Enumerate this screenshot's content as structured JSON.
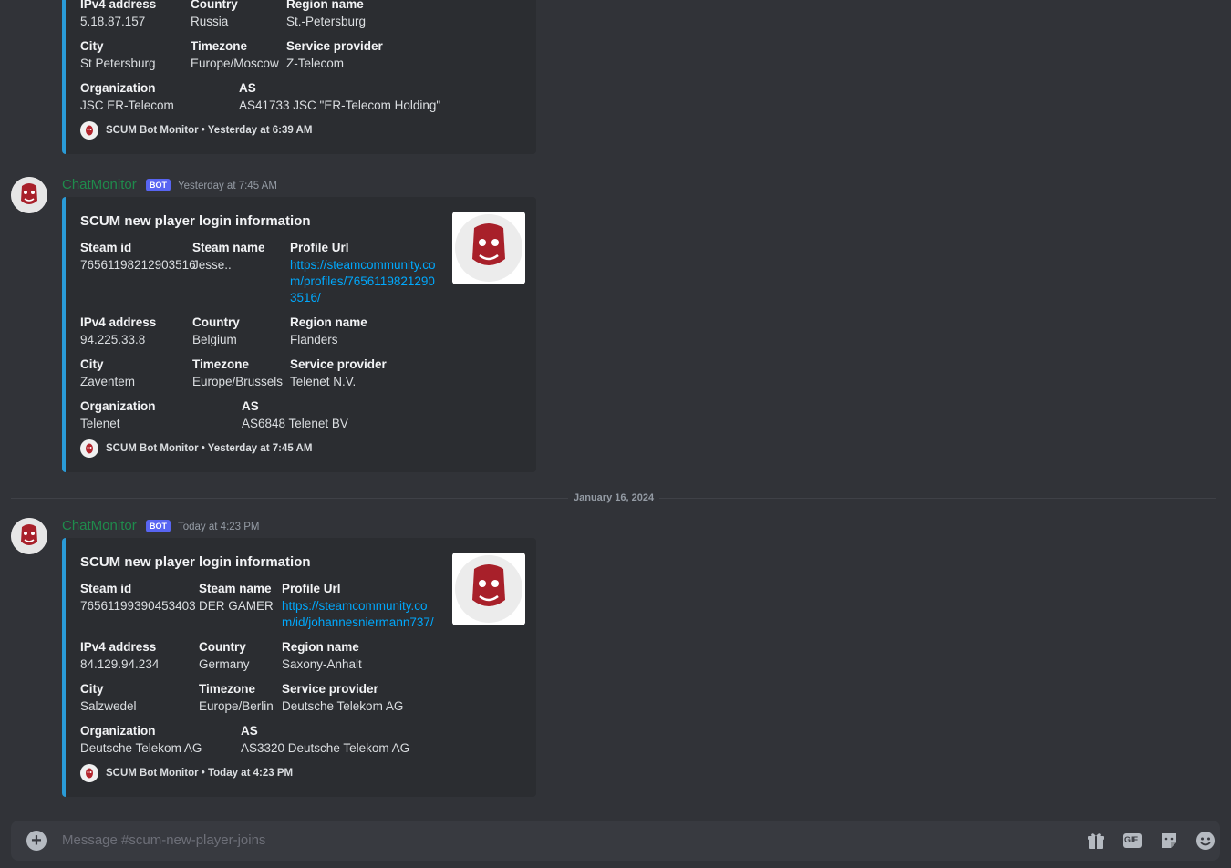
{
  "top_embed": {
    "row1": {
      "f1_name": "IPv4 address",
      "f1_value": "5.18.87.157",
      "f2_name": "Country",
      "f2_value": "Russia",
      "f3_name": "Region name",
      "f3_value": "St.-Petersburg"
    },
    "row2": {
      "f1_name": "City",
      "f1_value": "St Petersburg",
      "f2_name": "Timezone",
      "f2_value": "Europe/Moscow",
      "f3_name": "Service provider",
      "f3_value": "Z-Telecom"
    },
    "row3": {
      "f1_name": "Organization",
      "f1_value": "JSC ER-Telecom",
      "f2_name": "AS",
      "f2_value": "AS41733 JSC \"ER-Telecom Holding\""
    },
    "footer": "SCUM Bot Monitor • Yesterday at 6:39 AM"
  },
  "messages": [
    {
      "username": "ChatMonitor",
      "bot_tag": "BOT",
      "timestamp": "Yesterday at 7:45 AM",
      "embed": {
        "title": "SCUM new player login information",
        "row1": {
          "f1_name": "Steam id",
          "f1_value": "76561198212903516",
          "f2_name": "Steam name",
          "f2_value": "Jesse..",
          "f3_name": "Profile Url",
          "f3_value": "https://steamcommunity.com/profiles/76561198212903516/"
        },
        "row2": {
          "f1_name": "IPv4 address",
          "f1_value": "94.225.33.8",
          "f2_name": "Country",
          "f2_value": "Belgium",
          "f3_name": "Region name",
          "f3_value": "Flanders"
        },
        "row3": {
          "f1_name": "City",
          "f1_value": "Zaventem",
          "f2_name": "Timezone",
          "f2_value": "Europe/Brussels",
          "f3_name": "Service provider",
          "f3_value": "Telenet N.V."
        },
        "row4": {
          "f1_name": "Organization",
          "f1_value": "Telenet",
          "f2_name": "AS",
          "f2_value": "AS6848 Telenet BV"
        },
        "footer": "SCUM Bot Monitor • Yesterday at 7:45 AM"
      }
    },
    {
      "username": "ChatMonitor",
      "bot_tag": "BOT",
      "timestamp": "Today at 4:23 PM",
      "embed": {
        "title": "SCUM new player login information",
        "row1": {
          "f1_name": "Steam id",
          "f1_value": "76561199390453403",
          "f2_name": "Steam name",
          "f2_value": "DER GAMER",
          "f3_name": "Profile Url",
          "f3_value": "https://steamcommunity.com/id/johannesniermann737/"
        },
        "row2": {
          "f1_name": "IPv4 address",
          "f1_value": "84.129.94.234",
          "f2_name": "Country",
          "f2_value": "Germany",
          "f3_name": "Region name",
          "f3_value": "Saxony-Anhalt"
        },
        "row3": {
          "f1_name": "City",
          "f1_value": "Salzwedel",
          "f2_name": "Timezone",
          "f2_value": "Europe/Berlin",
          "f3_name": "Service provider",
          "f3_value": "Deutsche Telekom AG"
        },
        "row4": {
          "f1_name": "Organization",
          "f1_value": "Deutsche Telekom AG",
          "f2_name": "AS",
          "f2_value": "AS3320 Deutsche Telekom AG"
        },
        "footer": "SCUM Bot Monitor • Today at 4:23 PM"
      }
    }
  ],
  "date_divider": "January 16, 2024",
  "composer": {
    "placeholder": "Message #scum-new-player-joins",
    "icons": [
      "plus-icon",
      "gift-icon",
      "gif-icon",
      "sticker-icon",
      "emoji-icon"
    ],
    "gif_label": "GIF"
  },
  "colors": {
    "embed_accent": "#2a9bd7",
    "username": "#1f8b4c",
    "bot_tag": "#5865f2",
    "link": "#00a8fc"
  }
}
